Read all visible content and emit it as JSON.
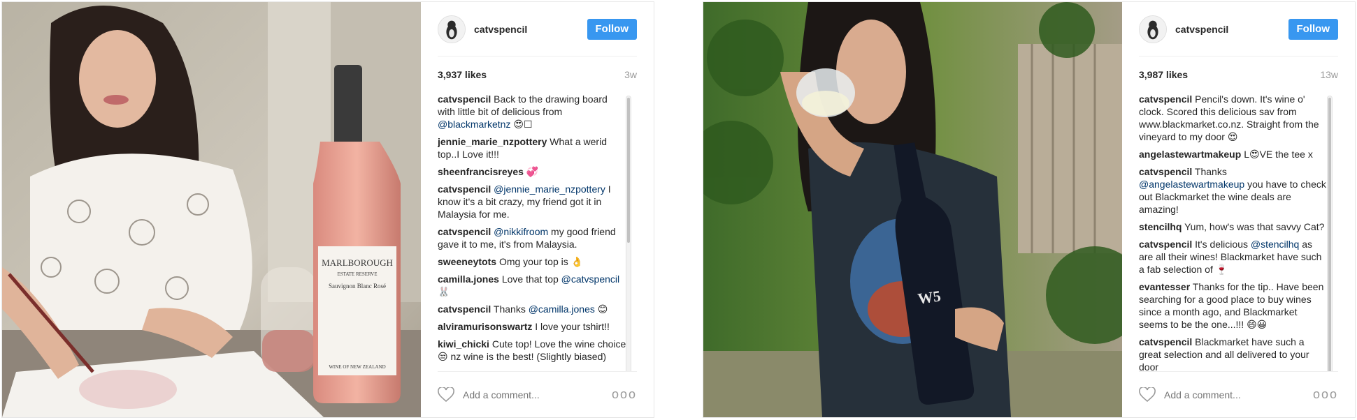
{
  "posts": [
    {
      "username": "catvspencil",
      "follow_label": "Follow",
      "likes": "3,937 likes",
      "ago": "3w",
      "add_comment_placeholder": "Add a comment...",
      "more_label": "ooo",
      "comments": [
        {
          "user": "catvspencil",
          "parts": [
            {
              "t": "Back to the drawing board with little bit of delicious from "
            },
            {
              "m": "@blackmarketnz"
            },
            {
              "t": " 😍☐"
            }
          ]
        },
        {
          "user": "jennie_marie_nzpottery",
          "parts": [
            {
              "t": "What a werid top..I Love it!!!"
            }
          ]
        },
        {
          "user": "sheenfrancisreyes",
          "parts": [
            {
              "t": "💞"
            }
          ]
        },
        {
          "user": "catvspencil",
          "parts": [
            {
              "m": "@jennie_marie_nzpottery"
            },
            {
              "t": " I know it's a bit crazy, my friend got it in Malaysia for me."
            }
          ]
        },
        {
          "user": "catvspencil",
          "parts": [
            {
              "m": "@nikkifroom"
            },
            {
              "t": " my good friend gave it to me, it's from Malaysia."
            }
          ]
        },
        {
          "user": "sweeneytots",
          "parts": [
            {
              "t": "Omg your top is 👌"
            }
          ]
        },
        {
          "user": "camilla.jones",
          "parts": [
            {
              "t": "Love that top "
            },
            {
              "m": "@catvspencil"
            },
            {
              "t": " 🐰"
            }
          ]
        },
        {
          "user": "catvspencil",
          "parts": [
            {
              "t": "Thanks "
            },
            {
              "m": "@camilla.jones"
            },
            {
              "t": " 😊"
            }
          ]
        },
        {
          "user": "alviramurisonswartz",
          "parts": [
            {
              "t": "I love your tshirt!!"
            }
          ]
        },
        {
          "user": "kiwi_chicki",
          "parts": [
            {
              "t": "Cute top! Love the wine choice 😒 nz wine is the best! (Slightly biased)"
            }
          ]
        }
      ]
    },
    {
      "username": "catvspencil",
      "follow_label": "Follow",
      "likes": "3,987 likes",
      "ago": "13w",
      "add_comment_placeholder": "Add a comment...",
      "more_label": "ooo",
      "comments": [
        {
          "user": "catvspencil",
          "parts": [
            {
              "t": "Pencil's down. It's wine o' clock. Scored this delicious sav from www.blackmarket.co.nz. Straight from the vineyard to my door 😍"
            }
          ]
        },
        {
          "user": "angelastewartmakeup",
          "parts": [
            {
              "t": "L😍VE the tee x"
            }
          ]
        },
        {
          "user": "catvspencil",
          "parts": [
            {
              "t": "Thanks "
            },
            {
              "m": "@angelastewartmakeup"
            },
            {
              "t": " you have to check out Blackmarket the wine deals are amazing!"
            }
          ]
        },
        {
          "user": "stencilhq",
          "parts": [
            {
              "t": "Yum, how's was that savvy Cat?"
            }
          ]
        },
        {
          "user": "catvspencil",
          "parts": [
            {
              "t": "It's delicious "
            },
            {
              "m": "@stencilhq"
            },
            {
              "t": " as are all their wines! Blackmarket have such a fab selection of 🍷"
            }
          ]
        },
        {
          "user": "evantesser",
          "parts": [
            {
              "t": "Thanks for the tip.. Have been searching for a good place to buy wines since a month ago, and Blackmarket seems to be the one...!!! 😄😀"
            }
          ]
        },
        {
          "user": "catvspencil",
          "parts": [
            {
              "t": "Blackmarket have such a great selection and all delivered to your door"
            }
          ]
        }
      ]
    }
  ],
  "photo1": {
    "label_title": "MARLBOROUGH",
    "label_sub": "ESTATE RESERVE",
    "label_wine": "Sauvignon Blanc Rosé",
    "label_foot": "WINE OF NEW ZEALAND"
  },
  "photo2": {
    "bottle_label": "W5"
  },
  "colors": {
    "follow": "#3897f0",
    "mention": "#003569",
    "muted": "#999999"
  }
}
